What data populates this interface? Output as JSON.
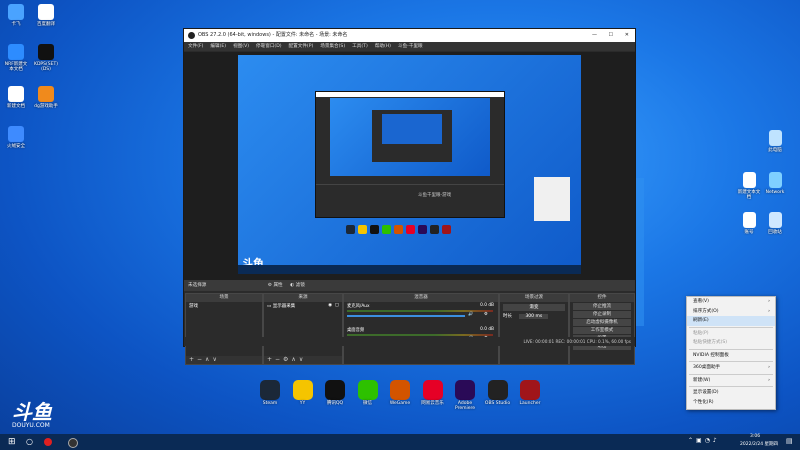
{
  "desktop_left": [
    {
      "name": "desktop-icon-app1",
      "label": "卡飞",
      "color": "#4aa3ff"
    },
    {
      "name": "desktop-icon-app2",
      "label": "百度翻译",
      "color": "#ffffff"
    },
    {
      "name": "desktop-icon-app3",
      "label": "NRF新建文本文档",
      "color": "#2d8cff"
    },
    {
      "name": "desktop-icon-obs-live",
      "label": "KDPS(SET) (DS)",
      "color": "#111111"
    },
    {
      "name": "desktop-icon-doc",
      "label": "新建文档",
      "color": "#ffffff"
    },
    {
      "name": "desktop-icon-tool",
      "label": "dg游戏助手",
      "color": "#f08a1c"
    },
    {
      "name": "desktop-icon-security",
      "label": "火绒安全",
      "color": "#3e8bff"
    }
  ],
  "desktop_right": [
    {
      "name": "desktop-icon-thispc",
      "label": "此电脑"
    },
    {
      "name": "desktop-icon-newtext",
      "label": "新建文本文档"
    },
    {
      "name": "desktop-icon-network",
      "label": "Network"
    },
    {
      "name": "desktop-icon-account",
      "label": "账号"
    },
    {
      "name": "desktop-icon-recycle",
      "label": "回收站"
    }
  ],
  "obs": {
    "title": "OBS 27.2.0 (64-bit, windows) - 配置文件: 未命名 - 场景: 未命名",
    "menu": [
      "文件(F)",
      "编辑(E)",
      "视图(V)",
      "停靠窗口(D)",
      "配置文件(P)",
      "场景集合(S)",
      "工具(T)",
      "帮助(H)",
      "斗鱼-千里眼"
    ],
    "source_bar": "未选择源",
    "source_props": "属性",
    "source_filters": "滤镜",
    "scenes_header": "场景",
    "scenes_item": "游戏",
    "sources_header": "来源",
    "sources_item": "显示器采集",
    "mixer_header": "混音器",
    "mixer_ch1": "麦克风/Aux",
    "mixer_ch1_db": "0.0 dB",
    "mixer_ch2": "桌面音频",
    "mixer_ch2_db": "0.0 dB",
    "transitions_header": "场景过渡",
    "transition_type": "渐变",
    "duration_label": "时长",
    "duration_value": "300 ms",
    "controls_header": "控件",
    "controls": [
      "停止推流",
      "停止录制",
      "启动虚拟摄像机",
      "工作室模式",
      "设置",
      "退出"
    ],
    "status": "LIVE: 00:00:01   REC: 00:00:01   CPU: 0.1%, 60.00 fps",
    "preview_logo": "斗鱼"
  },
  "context_menu": [
    {
      "label": "查看(V)",
      "arrow": "›",
      "type": "item"
    },
    {
      "label": "排序方式(O)",
      "arrow": "›",
      "type": "item"
    },
    {
      "label": "刷新(E)",
      "type": "item",
      "highlight": true
    },
    {
      "type": "sep"
    },
    {
      "label": "粘贴(P)",
      "type": "item",
      "disabled": true
    },
    {
      "label": "粘贴快捷方式(S)",
      "type": "item",
      "disabled": true
    },
    {
      "type": "sep"
    },
    {
      "label": "NVIDIA 控制面板",
      "type": "item"
    },
    {
      "type": "sep"
    },
    {
      "label": "360桌面助手",
      "arrow": "›",
      "type": "item"
    },
    {
      "type": "sep"
    },
    {
      "label": "新建(W)",
      "arrow": "›",
      "type": "item"
    },
    {
      "type": "sep"
    },
    {
      "label": "显示设置(D)",
      "type": "item"
    },
    {
      "label": "个性化(R)",
      "type": "item"
    }
  ],
  "dock": [
    {
      "name": "dock-steam",
      "label": "Steam",
      "color": "#1b2838"
    },
    {
      "name": "dock-yy",
      "label": "YY",
      "color": "#f5c400"
    },
    {
      "name": "dock-qq",
      "label": "腾讯QQ",
      "color": "#111111"
    },
    {
      "name": "dock-wechat",
      "label": "微信",
      "color": "#2dc100"
    },
    {
      "name": "dock-wegame",
      "label": "WeGame",
      "color": "#d35400"
    },
    {
      "name": "dock-netease-music",
      "label": "网易云音乐",
      "color": "#e60026"
    },
    {
      "name": "dock-premiere",
      "label": "Adobe Premiere",
      "color": "#2a0a57"
    },
    {
      "name": "dock-obs",
      "label": "OBS Studio",
      "color": "#222222"
    },
    {
      "name": "dock-launcher",
      "label": "Launcher",
      "color": "#a0151a"
    }
  ],
  "watermark": "斗鱼",
  "watermark_sub": "DOUYU.COM",
  "clock_time": "3:06",
  "clock_date": "2022/2/24 星期四"
}
